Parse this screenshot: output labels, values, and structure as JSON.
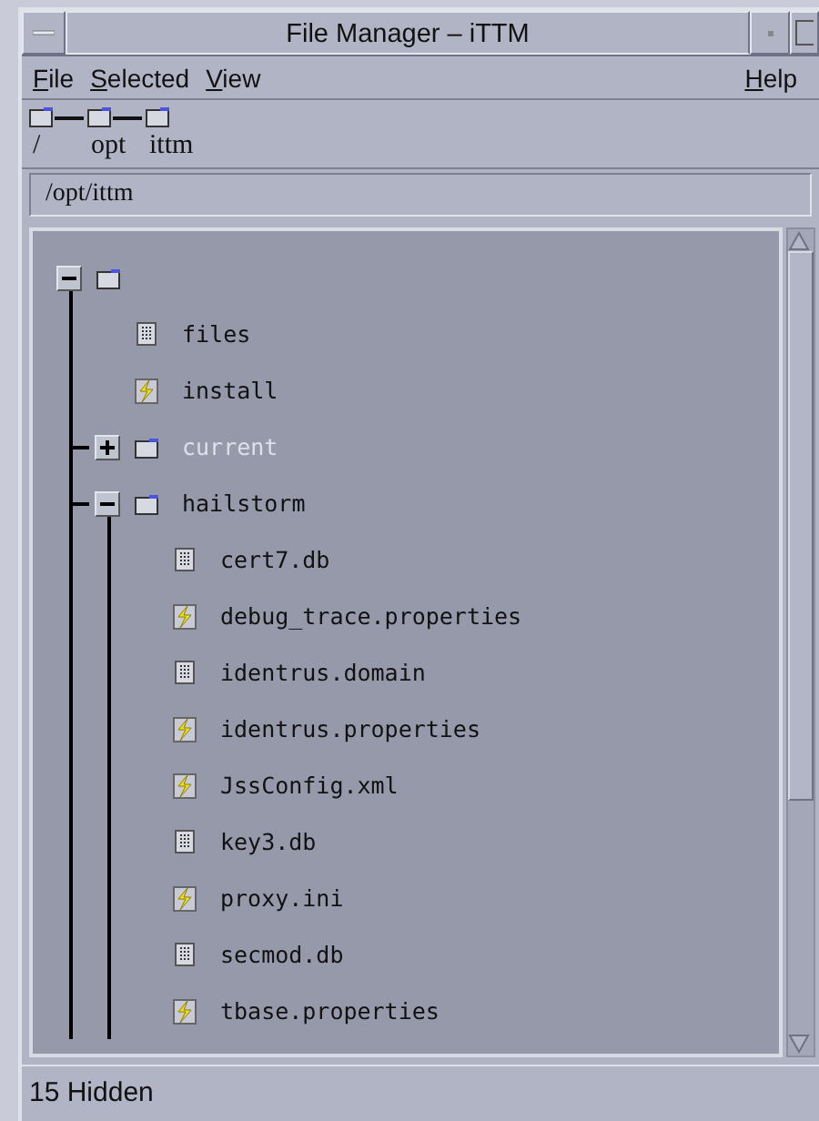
{
  "window": {
    "title": "File Manager – iTTM"
  },
  "menu": [
    {
      "label": "File"
    },
    {
      "label": "Selected"
    },
    {
      "label": "View"
    },
    {
      "label": "Help"
    }
  ],
  "breadcrumb": [
    {
      "label": "/"
    },
    {
      "label": "opt"
    },
    {
      "label": "ittm"
    }
  ],
  "path_field": {
    "value": "/opt/ittm"
  },
  "tree": {
    "kind": "folder",
    "expanded": true,
    "children": [
      {
        "kind": "file",
        "label": "files"
      },
      {
        "kind": "script",
        "label": "install"
      },
      {
        "kind": "folder",
        "label": "current",
        "expanded": false,
        "dimmed": true
      },
      {
        "kind": "folder",
        "label": "hailstorm",
        "expanded": true,
        "dimmed": false,
        "children": [
          {
            "kind": "file",
            "label": "cert7.db"
          },
          {
            "kind": "script",
            "label": "debug_trace.properties"
          },
          {
            "kind": "file",
            "label": "identrus.domain"
          },
          {
            "kind": "script",
            "label": "identrus.properties"
          },
          {
            "kind": "script",
            "label": "JssConfig.xml"
          },
          {
            "kind": "file",
            "label": "key3.db"
          },
          {
            "kind": "script",
            "label": "proxy.ini"
          },
          {
            "kind": "file",
            "label": "secmod.db"
          },
          {
            "kind": "script",
            "label": "tbase.properties"
          }
        ]
      }
    ]
  },
  "status_bar": {
    "text": "15 Hidden"
  }
}
